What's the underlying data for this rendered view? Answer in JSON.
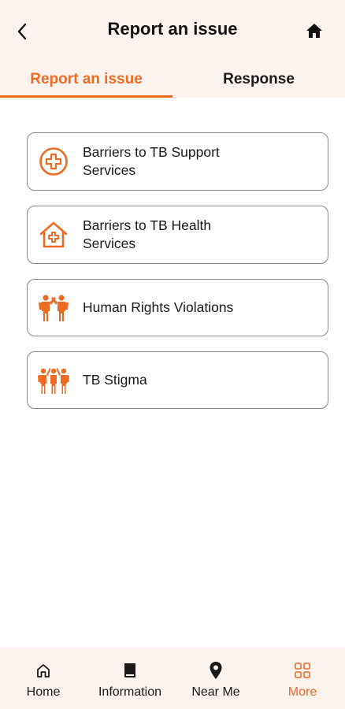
{
  "header": {
    "title": "Report an issue",
    "back_icon": "chevron-left-icon",
    "home_icon": "home-icon"
  },
  "tabs": [
    {
      "label": "Report an issue",
      "active": true
    },
    {
      "label": "Response",
      "active": false
    }
  ],
  "issues": [
    {
      "label": "Barriers to TB Support Services",
      "icon": "medical-cross-circle-icon"
    },
    {
      "label": "Barriers to TB Health Services",
      "icon": "health-house-icon"
    },
    {
      "label": "Human Rights Violations",
      "icon": "people-raised-hand-icon"
    },
    {
      "label": "TB Stigma",
      "icon": "group-people-icon"
    }
  ],
  "bottom_nav": [
    {
      "label": "Home",
      "icon": "home-outline-icon",
      "active": false
    },
    {
      "label": "Information",
      "icon": "book-icon",
      "active": false
    },
    {
      "label": "Near Me",
      "icon": "location-pin-icon",
      "active": false
    },
    {
      "label": "More",
      "icon": "grid-icon",
      "active": true
    }
  ],
  "colors": {
    "accent": "#ef6a22",
    "header_bg": "#fdf3ee",
    "card_border": "#8a8a8a",
    "text": "#1a1a1a"
  }
}
